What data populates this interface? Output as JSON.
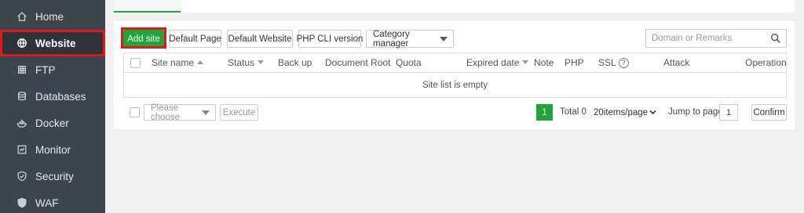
{
  "sidebar": {
    "items": [
      {
        "label": "Home",
        "icon": "home-icon"
      },
      {
        "label": "Website",
        "icon": "globe-icon"
      },
      {
        "label": "FTP",
        "icon": "ftp-icon"
      },
      {
        "label": "Databases",
        "icon": "database-icon"
      },
      {
        "label": "Docker",
        "icon": "docker-icon"
      },
      {
        "label": "Monitor",
        "icon": "monitor-icon"
      },
      {
        "label": "Security",
        "icon": "shield-icon"
      },
      {
        "label": "WAF",
        "icon": "waf-shield-icon"
      }
    ],
    "active_index": 1
  },
  "toolbar": {
    "add_site": "Add site",
    "default_page": "Default Page",
    "default_website": "Default Website",
    "php_cli": "PHP CLI version",
    "category_manager": "Category manager"
  },
  "search": {
    "placeholder": "Domain or Remarks"
  },
  "table": {
    "columns": [
      "Site name",
      "Status",
      "Back up",
      "Document Root",
      "Quota",
      "Expired date",
      "Note",
      "PHP",
      "SSL",
      "Attack",
      "Operation"
    ],
    "ssl_help": "?",
    "empty_text": "Site list is empty"
  },
  "footer": {
    "batch_placeholder": "Please choose",
    "execute": "Execute",
    "current_page": "1",
    "total": "Total 0",
    "page_size": "20items/page",
    "jump_label": "Jump to page",
    "jump_value": "1",
    "confirm": "Confirm"
  },
  "colors": {
    "accent": "#20a53a",
    "highlight": "#e3161a",
    "sidebar_bg": "#3c444d"
  }
}
